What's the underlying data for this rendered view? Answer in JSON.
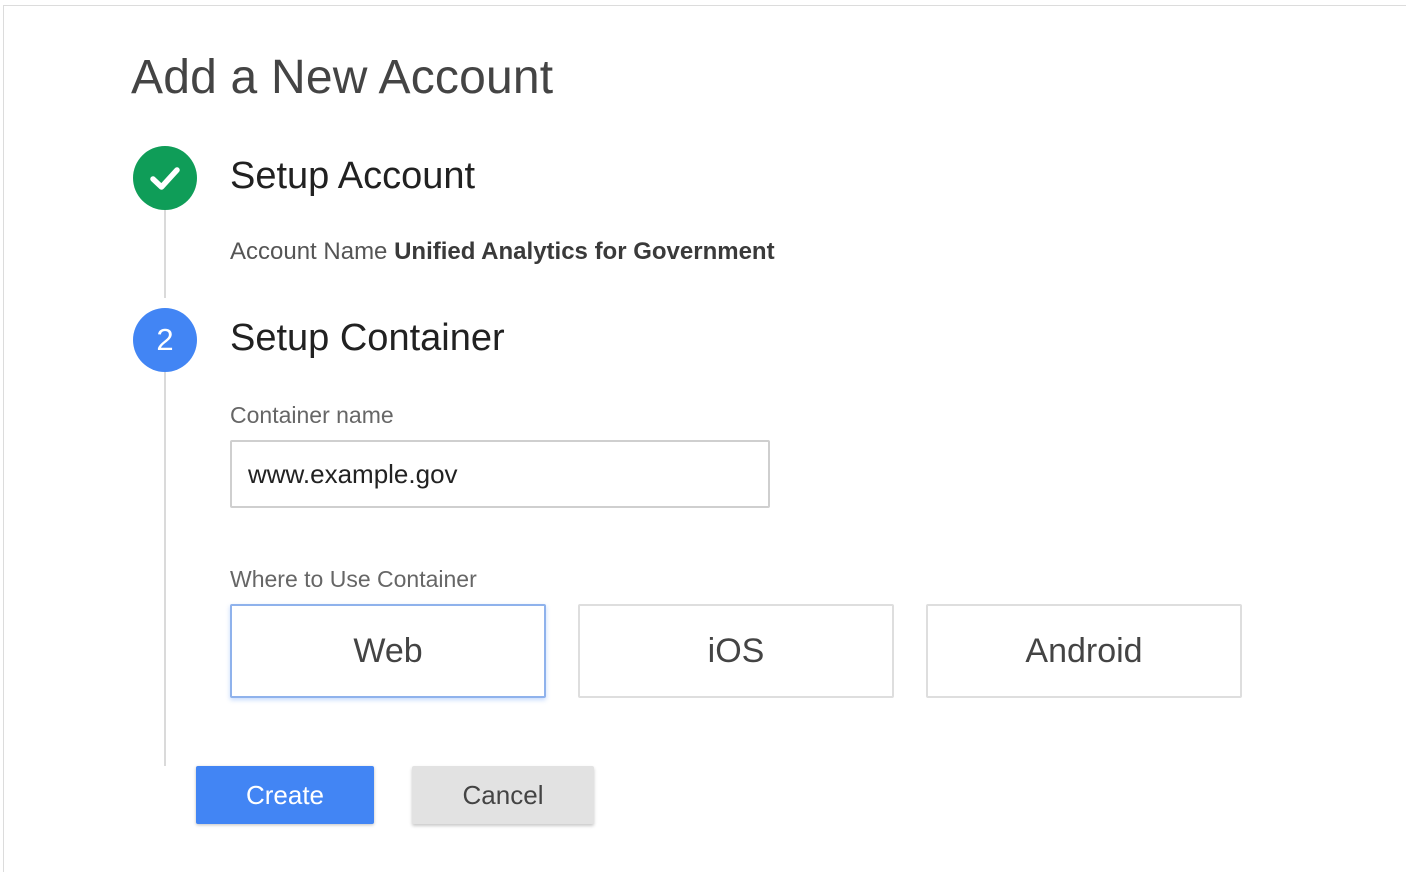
{
  "page": {
    "title": "Add a New Account"
  },
  "steps": [
    {
      "state": "complete",
      "indicator_icon": "check-icon",
      "title": "Setup Account",
      "account_name_label": "Account Name",
      "account_name_value": "Unified Analytics for Government"
    },
    {
      "state": "active",
      "indicator": "2",
      "title": "Setup Container",
      "container_name_label": "Container name",
      "container_name_value": "www.example.gov",
      "where_label": "Where to Use Container",
      "platforms": [
        {
          "label": "Web",
          "selected": true
        },
        {
          "label": "iOS",
          "selected": false
        },
        {
          "label": "Android",
          "selected": false
        }
      ]
    }
  ],
  "actions": {
    "create_label": "Create",
    "cancel_label": "Cancel"
  },
  "colors": {
    "complete_green": "#0f9d58",
    "active_blue": "#4285f4",
    "selected_border": "#8fb2ec",
    "cancel_gray": "#e2e2e2"
  }
}
